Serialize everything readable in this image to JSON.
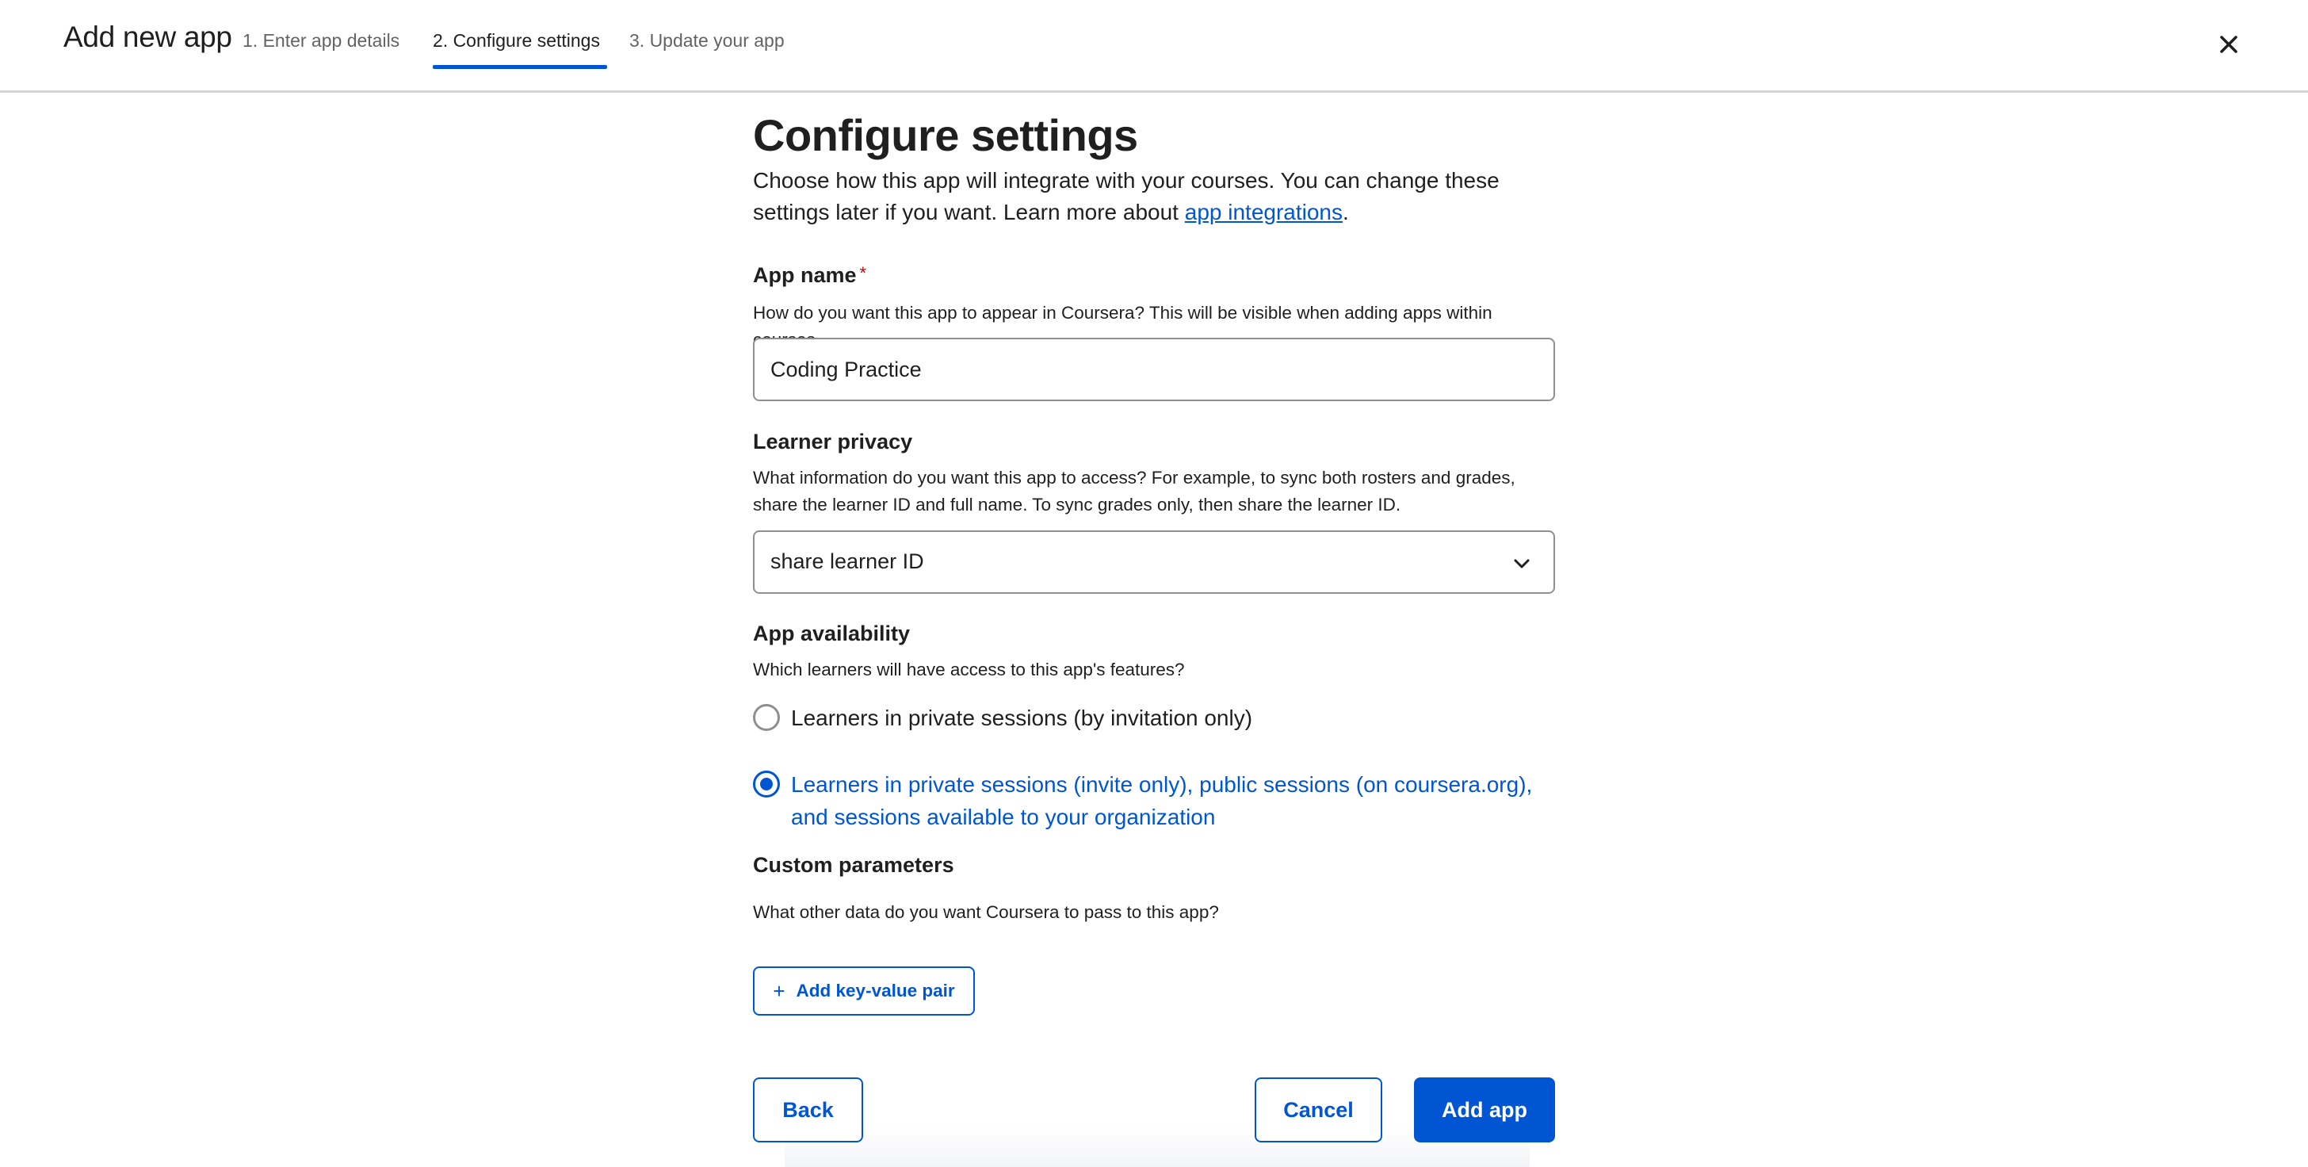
{
  "header": {
    "title": "Add new app",
    "steps": [
      "1. Enter app details",
      "2. Configure settings",
      "3. Update your app"
    ],
    "active_step": 2,
    "close_icon": "close-icon"
  },
  "main": {
    "heading": "Configure settings",
    "intro_text": "Choose how this app will integrate with your courses. You can change these settings later if you want. Learn more about ",
    "intro_link": "app integrations",
    "intro_end": ".",
    "app_name": {
      "label": "App name",
      "required_mark": "*",
      "help": "How do you want this app to appear in Coursera? This will be visible when adding apps within courses.",
      "value": "Coding Practice"
    },
    "learner_privacy": {
      "label": "Learner privacy",
      "help": "What information do you want this app to access? For example, to sync both rosters and grades, share the learner ID and full name. To sync grades only, then share the learner ID.",
      "selected": "share learner ID"
    },
    "availability": {
      "label": "App availability",
      "help": "Which learners will have access to this app's features?",
      "options": [
        "Learners in private sessions (by invitation only)",
        "Learners in private sessions (invite only), public sessions (on coursera.org), and sessions available to your organization"
      ],
      "selected_index": 1
    },
    "custom_params": {
      "label": "Custom parameters",
      "help": "What other data do you want Coursera to pass to this app?",
      "add_button": "Add key-value pair"
    }
  },
  "footer": {
    "back": "Back",
    "cancel": "Cancel",
    "add": "Add app"
  },
  "colors": {
    "accent": "#0056d2",
    "required": "#d30001",
    "text": "#1f1f1f",
    "muted": "#636363"
  }
}
